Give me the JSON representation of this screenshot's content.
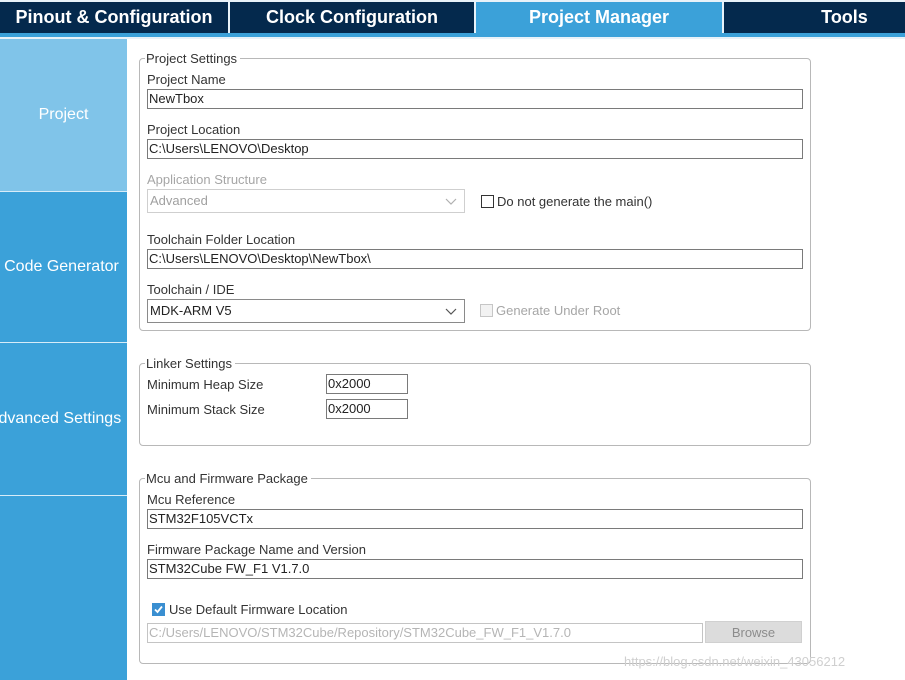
{
  "tabs": [
    {
      "label": "Pinout & Configuration"
    },
    {
      "label": "Clock Configuration"
    },
    {
      "label": "Project Manager"
    },
    {
      "label": "Tools"
    }
  ],
  "sidebar": {
    "items": [
      {
        "label": "Project"
      },
      {
        "label": "Code Generator"
      },
      {
        "label": "Advanced Settings"
      }
    ]
  },
  "project_settings": {
    "legend": "Project Settings",
    "project_name_label": "Project Name",
    "project_name_value": "NewTbox",
    "project_location_label": "Project Location",
    "project_location_value": "C:\\Users\\LENOVO\\Desktop",
    "app_structure_label": "Application Structure",
    "app_structure_value": "Advanced",
    "no_main_label": "Do not generate the main()",
    "toolchain_folder_label": "Toolchain Folder Location",
    "toolchain_folder_value": "C:\\Users\\LENOVO\\Desktop\\NewTbox\\",
    "toolchain_ide_label": "Toolchain / IDE",
    "toolchain_ide_value": "MDK-ARM V5",
    "generate_under_root_label": "Generate Under Root"
  },
  "linker_settings": {
    "legend": "Linker Settings",
    "heap_label": "Minimum Heap Size",
    "heap_value": "0x2000",
    "stack_label": "Minimum Stack Size",
    "stack_value": "0x2000"
  },
  "firmware": {
    "legend": "Mcu and Firmware Package",
    "mcu_ref_label": "Mcu Reference",
    "mcu_ref_value": "STM32F105VCTx",
    "package_label": "Firmware Package Name and Version",
    "package_value": "STM32Cube FW_F1 V1.7.0",
    "use_default_label": "Use Default Firmware Location",
    "location_value": "C:/Users/LENOVO/STM32Cube/Repository/STM32Cube_FW_F1_V1.7.0",
    "browse_label": "Browse"
  },
  "watermark": "https://blog.csdn.net/weixin_43056212",
  "colors": {
    "tab_dark": "#04294d",
    "accent": "#3ba1d9",
    "sidebar_active": "#80c4e9"
  }
}
